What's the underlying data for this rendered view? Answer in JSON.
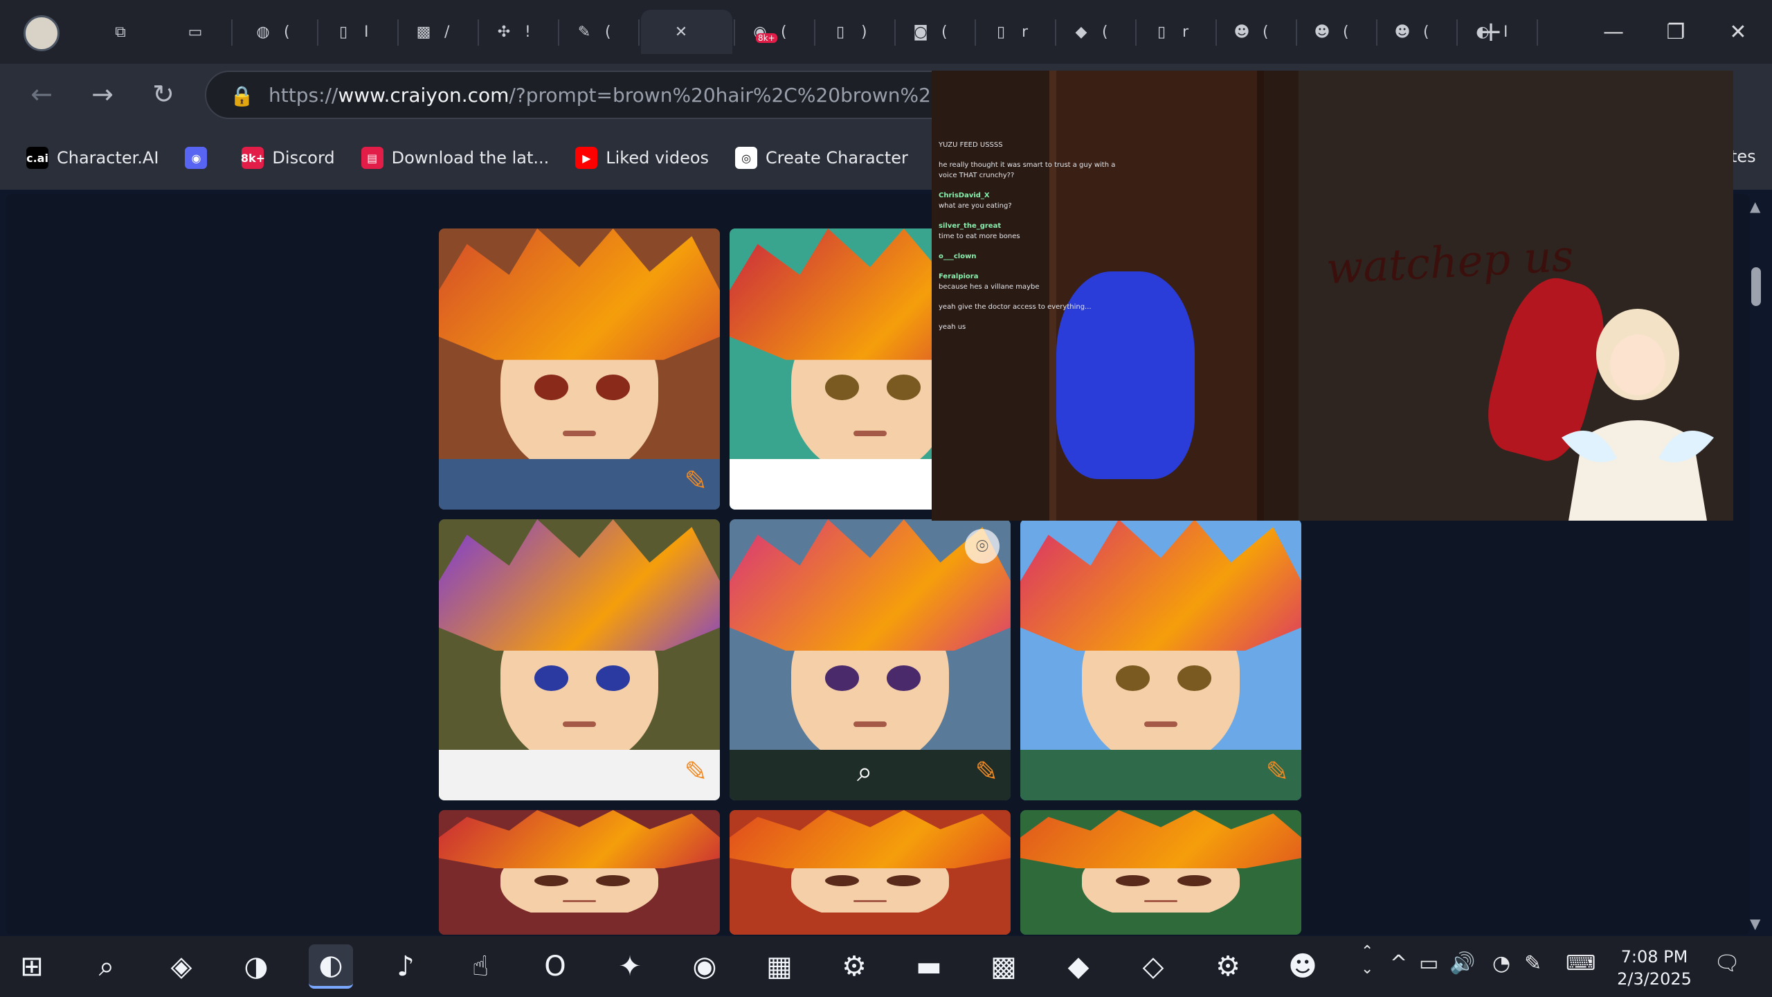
{
  "browser": {
    "tabs": [
      {
        "name": "tab-vertical-tabs",
        "icon": "vertical-tabs-icon"
      },
      {
        "name": "tab-workspaces",
        "icon": "workspaces-icon"
      },
      {
        "name": "tab-1",
        "label": "(",
        "icon": "globe-icon"
      },
      {
        "name": "tab-2",
        "label": "I",
        "icon": "page-icon"
      },
      {
        "name": "tab-3",
        "label": "/",
        "icon": "image-icon"
      },
      {
        "name": "tab-4",
        "label": "!",
        "icon": "pinwheel-icon"
      },
      {
        "name": "tab-5",
        "label": "(",
        "icon": "pencil-icon"
      },
      {
        "name": "tab-6-active",
        "label": "",
        "icon": "close-icon"
      },
      {
        "name": "tab-7",
        "label": "(",
        "icon": "discord-icon",
        "badge": "8k+"
      },
      {
        "name": "tab-8",
        "label": ")",
        "icon": "page-icon"
      },
      {
        "name": "tab-9",
        "label": "(",
        "icon": "camera-icon"
      },
      {
        "name": "tab-10",
        "label": "r",
        "icon": "page-icon"
      },
      {
        "name": "tab-11",
        "label": "(",
        "icon": "cube-icon"
      },
      {
        "name": "tab-12",
        "label": "r",
        "icon": "page-icon"
      },
      {
        "name": "tab-13",
        "label": "(",
        "icon": "mascot-icon"
      },
      {
        "name": "tab-14",
        "label": "(",
        "icon": "mascot-icon"
      },
      {
        "name": "tab-15",
        "label": "(",
        "icon": "mascot-icon"
      },
      {
        "name": "tab-16",
        "label": "I",
        "icon": "edge-icon"
      }
    ],
    "new_tab_label": "+",
    "url_host_prefix": "https://",
    "url_host": "www.craiyon.com",
    "url_path": "/?prompt=brown%20hair%2C%20brown%20eyes%2",
    "bookmarks": [
      {
        "label": "Character.AI",
        "icon_text": "c.ai",
        "color": "#000000"
      },
      {
        "label": "",
        "icon_text": "◉",
        "color": "#5865f2"
      },
      {
        "label": "Discord",
        "icon_text": "8k+",
        "color": "#e11d48"
      },
      {
        "label": "Download the lat...",
        "icon_text": "▤",
        "color": "#e11d48"
      },
      {
        "label": "Liked videos",
        "icon_text": "▶",
        "color": "#ff0000"
      },
      {
        "label": "Create Character",
        "icon_text": "◎",
        "color": "#ffffff"
      }
    ],
    "bookmarks_overflow": "tes"
  },
  "gallery": {
    "tiles": [
      {
        "hair": "#d44b2a",
        "bg": "#8a4a2a",
        "shirt": "#3b5b86",
        "eyes": "#8a2a1a"
      },
      {
        "hair": "#c9273f",
        "bg": "#3aa58f",
        "shirt": "#ffffff",
        "eyes": "#7a5a20"
      },
      {
        "hair": "#7a3ad8",
        "bg": "#5a5a30",
        "shirt": "#f2f2f2",
        "eyes": "#2a3aa0"
      },
      {
        "hair": "#d8347a",
        "bg": "#5a7a9a",
        "shirt": "#1f2d28",
        "eyes": "#4a2a6a"
      },
      {
        "hair": "#d9306a",
        "bg": "#6aa8e8",
        "shirt": "#2f6a4a",
        "eyes": "#7a5a20"
      },
      {
        "hair": "#c92a35",
        "bg": "#7a2a2a",
        "shirt": "#7a2a2a",
        "eyes": "#5a2a1a"
      },
      {
        "hair": "#e04b1e",
        "bg": "#b33a1e",
        "shirt": "#b33a1e",
        "eyes": "#5a2a1a"
      },
      {
        "hair": "#e0571e",
        "bg": "#2f6a3a",
        "shirt": "#2f6a3a",
        "eyes": "#5a2a1a"
      }
    ]
  },
  "pip": {
    "graffiti": "watchep us",
    "chat": [
      {
        "user": "",
        "msg": "YUZU FEED USSSS"
      },
      {
        "user": "",
        "msg": "he really thought it was smart to trust a guy with a voice THAT crunchy??"
      },
      {
        "user": "ChrisDavid_X",
        "msg": "what are you eating?"
      },
      {
        "user": "silver_the_great",
        "msg": "time to eat more bones"
      },
      {
        "user": "o___clown",
        "msg": ""
      },
      {
        "user": "Feralpiora",
        "msg": "because hes a villane maybe"
      },
      {
        "user": "",
        "msg": "yeah give the doctor access to everything..."
      },
      {
        "user": "",
        "msg": "yeah us"
      }
    ]
  },
  "taskbar": {
    "apps": [
      "windows-start-icon",
      "search-icon",
      "copilot-icon",
      "globe-icon",
      "edge-icon",
      "tiktok-icon",
      "clicker-icon",
      "opera-icon",
      "paint-icon",
      "discord-icon",
      "minecraft-icon",
      "steam-icon",
      "file-explorer-icon",
      "store-icon",
      "roblox-icon",
      "crystal-icon",
      "settings-icon",
      "anime-app-icon"
    ],
    "time": "7:08 PM",
    "date": "2/3/2025"
  }
}
